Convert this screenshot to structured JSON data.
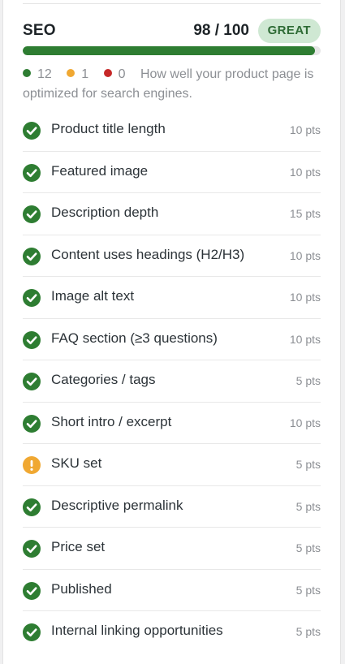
{
  "colors": {
    "ok": "#2e7d32",
    "warning": "#f0a832",
    "error": "#c62828"
  },
  "seo": {
    "title": "SEO",
    "score": "98 / 100",
    "score_value": 0.98,
    "badge": "GREAT",
    "counts": {
      "ok": "12",
      "warning": "1",
      "error": "0"
    },
    "description": "How well your product page is optimized for search engines."
  },
  "checks": [
    {
      "label": "Product title length",
      "points": "10 pts",
      "status": "ok"
    },
    {
      "label": "Featured image",
      "points": "10 pts",
      "status": "ok"
    },
    {
      "label": "Description depth",
      "points": "15 pts",
      "status": "ok"
    },
    {
      "label": "Content uses headings (H2/H3)",
      "points": "10 pts",
      "status": "ok"
    },
    {
      "label": "Image alt text",
      "points": "10 pts",
      "status": "ok"
    },
    {
      "label": "FAQ section (≥3 questions)",
      "points": "10 pts",
      "status": "ok"
    },
    {
      "label": "Categories / tags",
      "points": "5 pts",
      "status": "ok"
    },
    {
      "label": "Short intro / excerpt",
      "points": "10 pts",
      "status": "ok"
    },
    {
      "label": "SKU set",
      "points": "5 pts",
      "status": "warning"
    },
    {
      "label": "Descriptive permalink",
      "points": "5 pts",
      "status": "ok"
    },
    {
      "label": "Price set",
      "points": "5 pts",
      "status": "ok"
    },
    {
      "label": "Published",
      "points": "5 pts",
      "status": "ok"
    },
    {
      "label": "Internal linking opportunities",
      "points": "5 pts",
      "status": "ok"
    }
  ]
}
